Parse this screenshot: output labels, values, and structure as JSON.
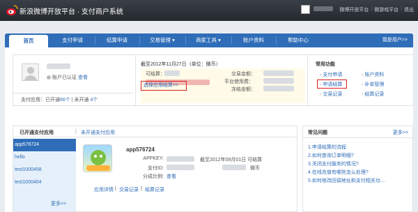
{
  "header": {
    "site_title": "新浪微博开放平台 · 支付商户系统",
    "links": [
      "微博开放平台",
      "微游戏平台",
      "退出"
    ]
  },
  "nav": {
    "items": [
      "首页",
      "支付申请",
      "结算申请",
      "交易管理",
      "商家工具",
      "账户资料",
      "帮助中心"
    ],
    "dropdown_arrow": "▾",
    "right_link": "我是用户>>"
  },
  "account": {
    "verify_text": "账户已认证",
    "verify_link": "查看",
    "apps_prefix": "支付应用：已开通",
    "apps_open_count": "66个",
    "apps_mid": "| 未开通",
    "apps_closed_count": "4个"
  },
  "balance": {
    "date_line": "截至2012年11月27日（单位：微币）",
    "settleable_label": "可结算：",
    "trade_amount_label": "交易金额：",
    "platform_fee_label": "平台使用费：",
    "frozen_label": "冻结金额：",
    "select_app_link": "选择应用结算>>"
  },
  "quick": {
    "title": "常用功能",
    "items": [
      "支付申请",
      "账户资料",
      "申请结算",
      "补单管理",
      "交易记录",
      "结算记录"
    ]
  },
  "apps": {
    "tab_open": "已开通支付应用",
    "tab_sep": "|",
    "tab_unopen": "未开通支付应用",
    "list": [
      "app576724",
      "hello",
      "test1000458",
      "test1000404"
    ],
    "more": "更多>>",
    "detail": {
      "name": "app576724",
      "appkey_label": "APPKEY:",
      "payment_id_label": "支付ID:",
      "split_ratio_label": "分成比例:",
      "split_ratio_link": "查看",
      "settle_date": "截至2012年09月01日 可结算",
      "unit": "微币",
      "links": [
        "应用详情",
        "交易记录",
        "结算记录"
      ],
      "link_sep": "|"
    }
  },
  "faq": {
    "title": "常见问题",
    "more": "更多>>",
    "items": [
      "1.申请结算的流程",
      "2.如何查询订单明细?",
      "3.关闭支付服务的情况?",
      "4.在线充值有哪些怎么处理?",
      "5.如何修改回调地址和支付相关功…"
    ]
  },
  "colors": {
    "brand_blue": "#2f6db8",
    "highlight_red": "#d62020",
    "topbar": "#2b3036"
  }
}
